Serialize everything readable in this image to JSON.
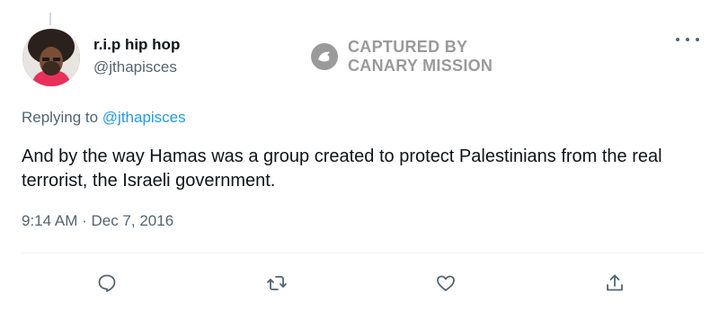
{
  "tweet": {
    "author_name": "r.i.p hip hop",
    "author_handle": "@jthapisces",
    "replying_prefix": "Replying to",
    "replying_handle": "@jthapisces",
    "text": "And by the way Hamas was a group created to protect Palestinians from the real terrorist, the Israeli government.",
    "timestamp": "9:14 AM · Dec 7, 2016"
  },
  "watermark": {
    "line1": "CAPTURED BY",
    "line2": "CANARY MISSION",
    "color": "#9a9a9a"
  },
  "icons": {
    "more": "more-dots-icon",
    "reply": "reply-icon",
    "retweet": "retweet-icon",
    "like": "like-icon",
    "share": "share-icon"
  },
  "colors": {
    "link": "#1d9bf0",
    "secondary": "#536471",
    "primary": "#0f1419"
  }
}
